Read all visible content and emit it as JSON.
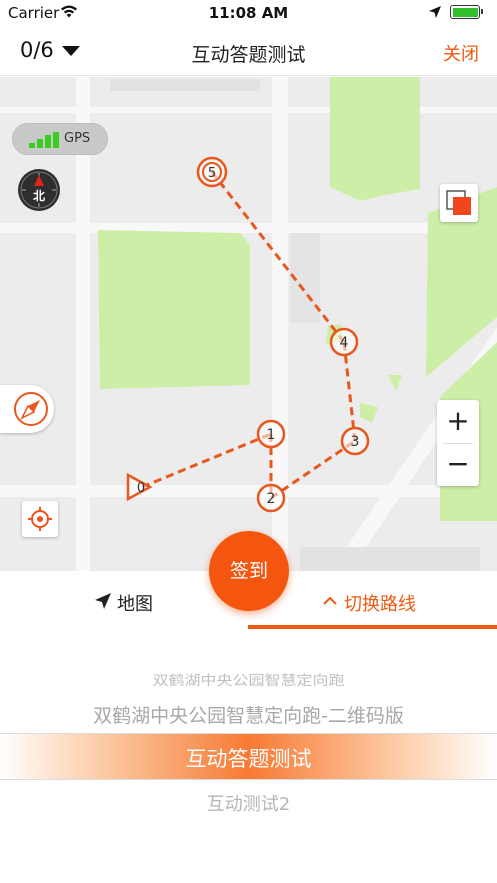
{
  "status_bar": {
    "carrier": "Carrier",
    "time": "11:08 AM",
    "icons": [
      "wifi-icon",
      "location-arrow-icon",
      "battery-icon"
    ]
  },
  "nav": {
    "progress": "0/6",
    "title": "互动答题测试",
    "close_label": "关闭"
  },
  "map": {
    "gps_label": "GPS",
    "compass_label": "北",
    "zoom_in_label": "+",
    "zoom_out_label": "−",
    "start_marker_label": "0",
    "checkpoints": [
      "1",
      "2",
      "3",
      "4",
      "5"
    ],
    "colors": {
      "route": "#e8571d",
      "park": "#cdeea7",
      "ground": "#ececec",
      "road": "#f8f8f8"
    }
  },
  "checkin_label": "签到",
  "tabs": {
    "map_label": "地图",
    "route_label": "切换路线",
    "active": "route"
  },
  "routes": [
    "双鹤湖中央公园智慧定向跑",
    "双鹤湖中央公园智慧定向跑-二维码版",
    "互动答题测试",
    "互动测试2"
  ],
  "selected_route_index": 2,
  "accent_color": "#f05a10"
}
